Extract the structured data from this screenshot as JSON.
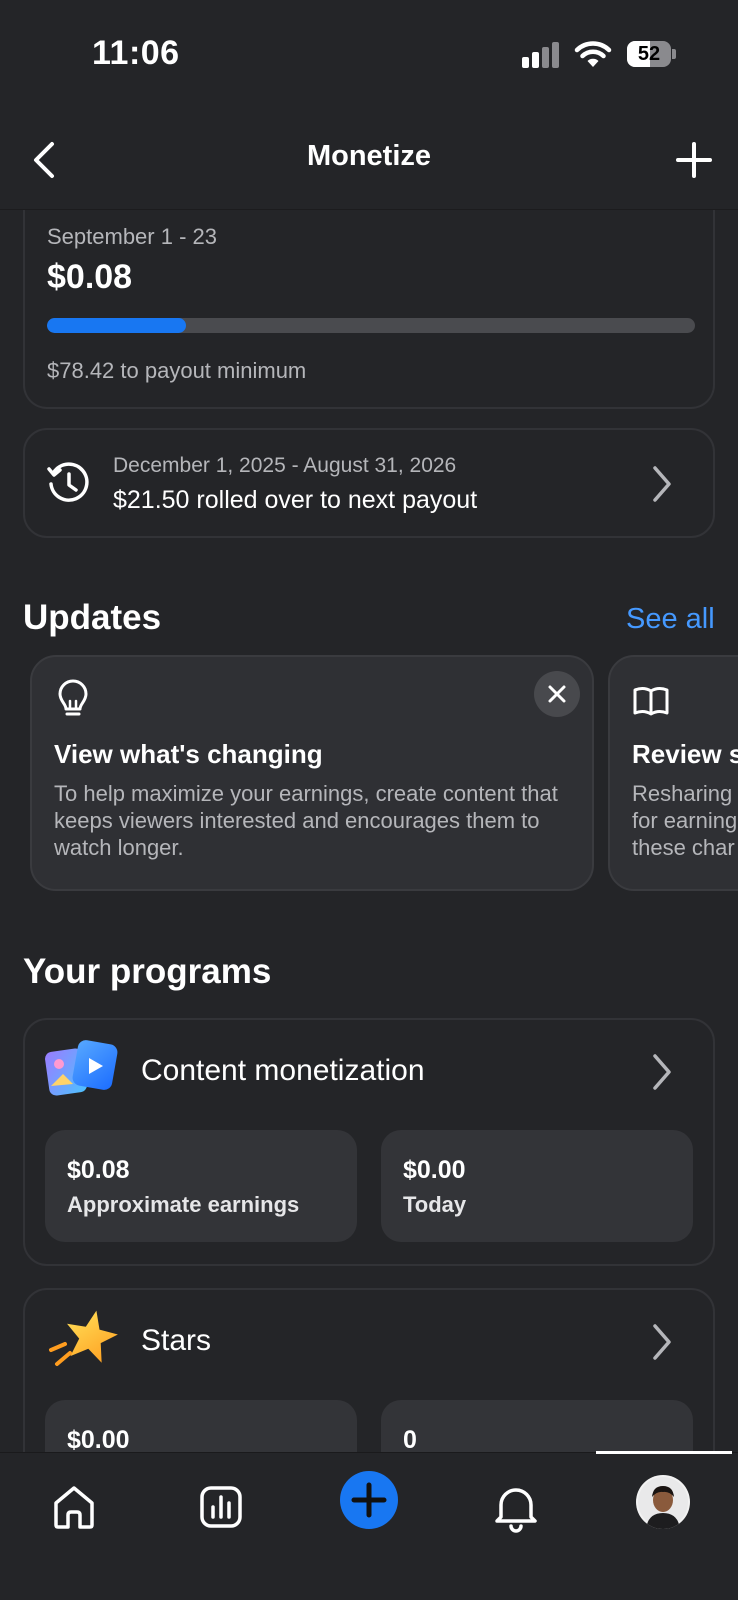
{
  "status_bar": {
    "time": "11:06",
    "battery_percent": "52",
    "battery_level": 0.52
  },
  "nav": {
    "title": "Monetize"
  },
  "earnings": {
    "date_range": "September 1 - 23",
    "amount": "$0.08",
    "progress_fraction": 0.215,
    "payout_note": "$78.42 to payout minimum",
    "accent_color": "#1877f2"
  },
  "rollover": {
    "date_range": "December 1, 2025 - August 31, 2026",
    "text": "$21.50 rolled over to next payout"
  },
  "updates": {
    "title": "Updates",
    "see_all_label": "See all",
    "cards": [
      {
        "icon": "lightbulb-icon",
        "title": "View what's changing",
        "description": "To help maximize your earnings, create content that keeps viewers interested and encourages them to watch longer."
      },
      {
        "icon": "book-icon",
        "title": "Review s",
        "description": "Resharing\nfor earning\nthese char"
      }
    ]
  },
  "programs": {
    "title": "Your programs",
    "items": [
      {
        "icon": "content-monetization-icon",
        "name": "Content monetization",
        "stats": [
          {
            "value": "$0.08",
            "label": "Approximate earnings"
          },
          {
            "value": "$0.00",
            "label": "Today"
          }
        ]
      },
      {
        "icon": "stars-icon",
        "name": "Stars",
        "stats": [
          {
            "value": "$0.00",
            "label": ""
          },
          {
            "value": "0",
            "label": ""
          }
        ]
      }
    ]
  },
  "tab_bar": {
    "items": [
      "home-icon",
      "insights-icon",
      "create-icon",
      "notifications-icon",
      "profile-avatar"
    ],
    "active": "profile-avatar"
  }
}
